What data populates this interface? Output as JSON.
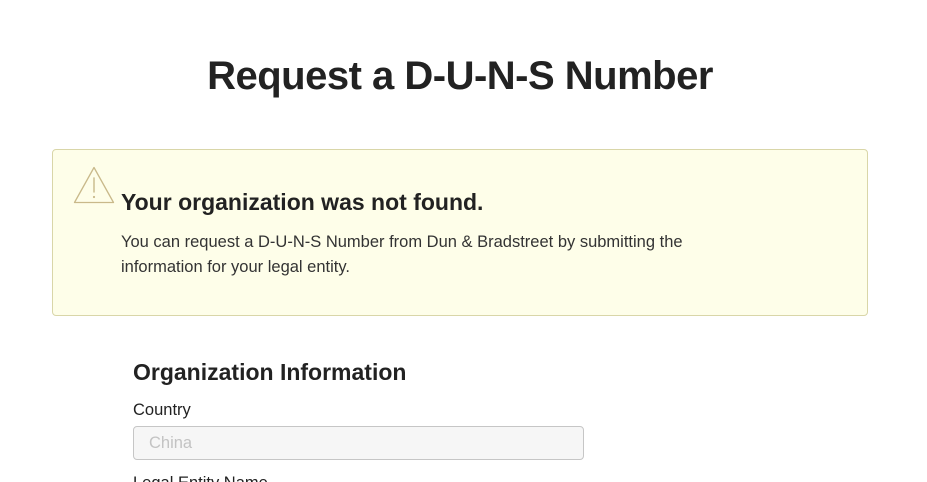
{
  "page": {
    "title": "Request a D-U-N-S Number"
  },
  "alert": {
    "icon": "warning-icon",
    "heading": "Your organization was not found.",
    "body": "You can request a D-U-N-S Number from Dun & Bradstreet by submitting the information for your legal entity.",
    "background_color": "#fefee9",
    "border_color": "#d9d6a8",
    "icon_color": "#c9b98a"
  },
  "form": {
    "section_title": "Organization Information",
    "country": {
      "label": "Country",
      "value": "China"
    },
    "legal_entity_name": {
      "label": "Legal Entity Name"
    }
  }
}
